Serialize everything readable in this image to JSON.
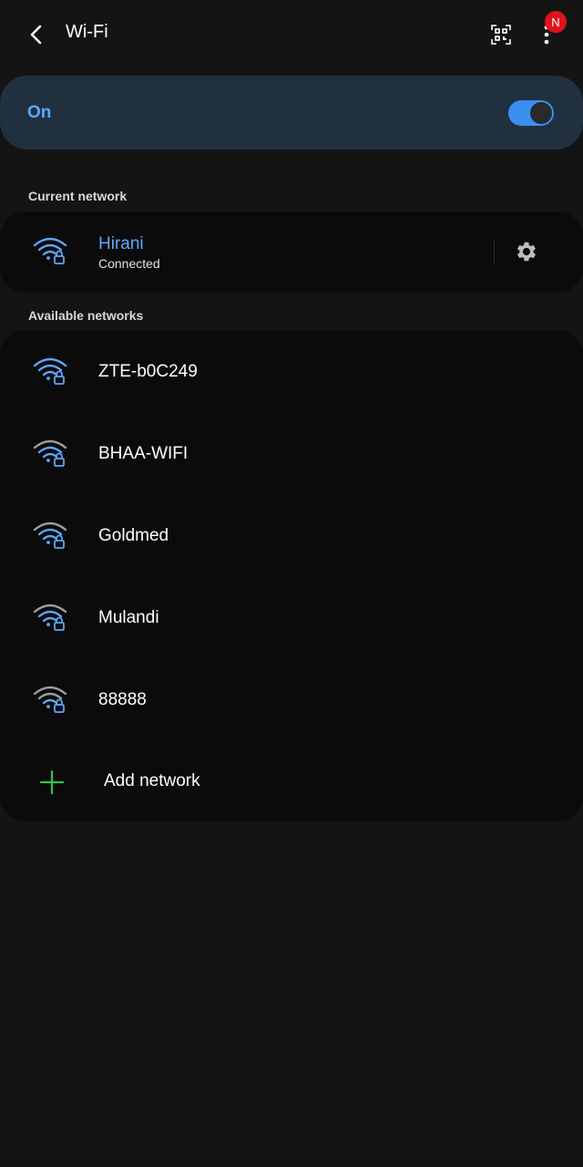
{
  "header": {
    "title": "Wi-Fi",
    "notification_badge": "N"
  },
  "wifi_toggle": {
    "label": "On",
    "state": "on",
    "accent_color": "#5ea7ff"
  },
  "current_network": {
    "section_label": "Current network",
    "name": "Hirani",
    "status": "Connected",
    "icon": "wifi-lock-icon"
  },
  "available_networks": {
    "section_label": "Available networks",
    "items": [
      {
        "name": "ZTE-b0C249",
        "icon": "wifi-lock-icon",
        "signal_bars": 3
      },
      {
        "name": "BHAA-WIFI",
        "icon": "wifi-lock-icon",
        "signal_bars": 2
      },
      {
        "name": "Goldmed",
        "icon": "wifi-lock-icon",
        "signal_bars": 2
      },
      {
        "name": "Mulandi",
        "icon": "wifi-lock-icon",
        "signal_bars": 2
      },
      {
        "name": "88888",
        "icon": "wifi-lock-icon",
        "signal_bars": 1
      }
    ],
    "add_network_label": "Add network"
  },
  "colors": {
    "background": "#141414",
    "card": "#0b0b0b",
    "on_card": "#20303f",
    "accent_blue": "#5ea7ff",
    "add_green": "#36c24a",
    "badge_red": "#e0121a"
  }
}
